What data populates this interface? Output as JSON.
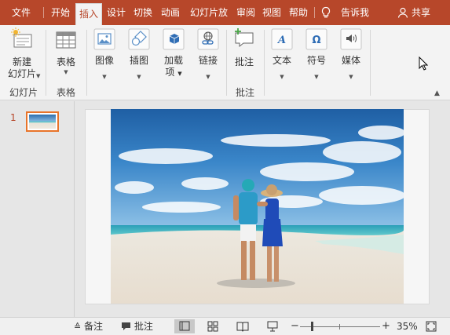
{
  "tabs": [
    {
      "label": "文件",
      "active": false
    },
    {
      "label": "开始",
      "active": false
    },
    {
      "label": "插入",
      "active": true
    },
    {
      "label": "设计",
      "active": false
    },
    {
      "label": "切换",
      "active": false
    },
    {
      "label": "动画",
      "active": false
    },
    {
      "label": "幻灯片放",
      "active": false
    },
    {
      "label": "审阅",
      "active": false
    },
    {
      "label": "视图",
      "active": false
    },
    {
      "label": "帮助",
      "active": false
    }
  ],
  "tell_me": "告诉我",
  "share": "共享",
  "ribbon": {
    "new_slide": {
      "line1": "新建",
      "line2": "幻灯片"
    },
    "table": "表格",
    "image": "图像",
    "illustration": "插图",
    "addins": {
      "line1": "加载",
      "line2": "项"
    },
    "link": "链接",
    "comment": "批注",
    "text": "文本",
    "symbol": "符号",
    "media": "媒体",
    "groups": {
      "slides": "幻灯片",
      "tables": "表格",
      "comments": "批注"
    }
  },
  "thumbnail": {
    "number": "1"
  },
  "status": {
    "notes": "备注",
    "comments": "批注",
    "zoom_minus": "−",
    "zoom_plus": "+",
    "zoom_level": "35%"
  },
  "colors": {
    "accent": "#b7472a",
    "thumb_border": "#e8742a"
  }
}
